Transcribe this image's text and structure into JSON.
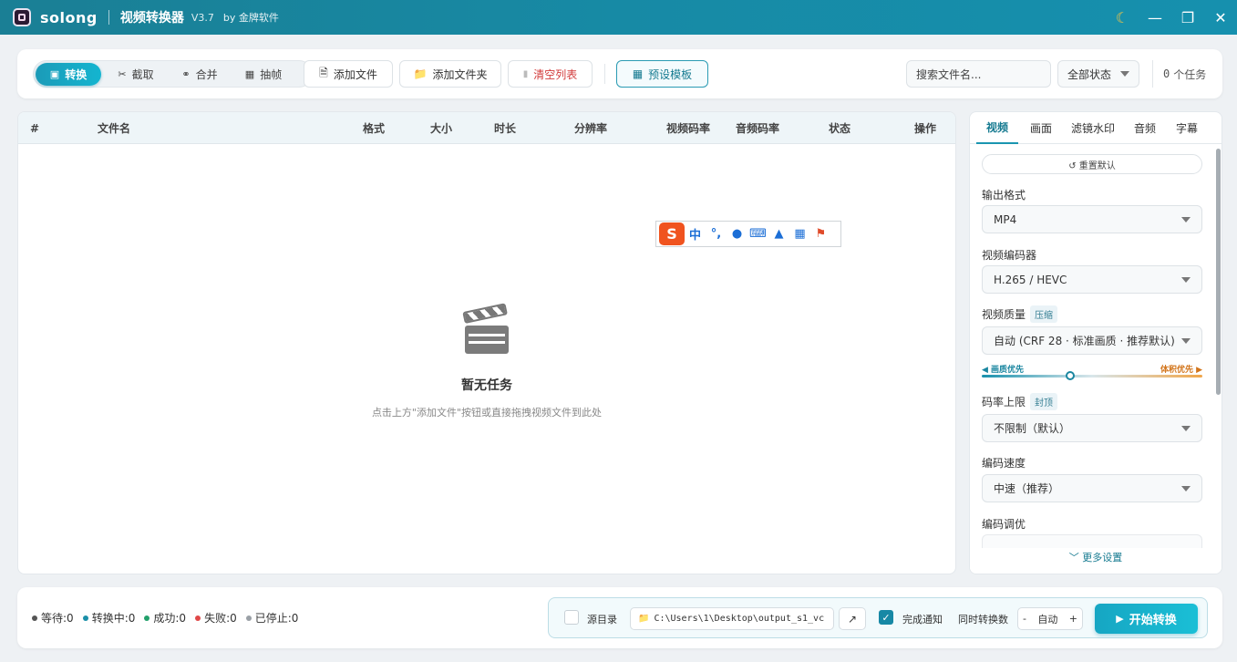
{
  "titlebar": {
    "app_name": "solong",
    "title": "视频转换器",
    "version": "V3.7",
    "by": "by 金牌软件",
    "theme_icon": "moon-icon",
    "minimize": "—",
    "maximize": "❐",
    "close": "✕"
  },
  "toolbar": {
    "modes": [
      {
        "label": "转换",
        "icon": "convert-icon",
        "active": true
      },
      {
        "label": "截取",
        "icon": "scissors-icon"
      },
      {
        "label": "合并",
        "icon": "link-icon"
      },
      {
        "label": "抽帧",
        "icon": "frame-icon"
      }
    ],
    "add_file": "添加文件",
    "add_folder": "添加文件夹",
    "clear_list": "清空列表",
    "preset": "预设模板",
    "search_placeholder": "搜索文件名...",
    "status_filter": "全部状态",
    "task_count": "0",
    "task_unit": "个任务"
  },
  "table": {
    "columns": [
      "#",
      "文件名",
      "格式",
      "大小",
      "时长",
      "分辨率",
      "视频码率",
      "音频码率",
      "状态",
      "操作"
    ],
    "empty_title": "暂无任务",
    "empty_hint": "点击上方\"添加文件\"按钮或直接拖拽视频文件到此处"
  },
  "ime": {
    "logo": "S",
    "items": [
      "中",
      "°,",
      "🎤",
      "⌨",
      "👕",
      "▦",
      "🔧"
    ]
  },
  "settings": {
    "tabs": [
      "视频",
      "画面",
      "滤镜水印",
      "音频",
      "字幕"
    ],
    "active_tab": "视频",
    "reset": "↺ 重置默认",
    "output_format_label": "输出格式",
    "output_format": "MP4",
    "encoder_label": "视频编码器",
    "encoder": "H.265 / HEVC",
    "quality_label": "视频质量",
    "quality_tag": "压缩",
    "quality": "自动 (CRF 28 · 标准画质 · 推荐默认)",
    "slider_left": "◀ 画质优先",
    "slider_right": "体积优先 ▶",
    "slider_value": 0.4,
    "bitrate_label": "码率上限",
    "bitrate_tag": "封顶",
    "bitrate": "不限制（默认）",
    "speed_label": "编码速度",
    "speed": "中速（推荐）",
    "tune_label": "编码调优",
    "more": "﹀ 更多设置"
  },
  "bottom": {
    "stats": [
      {
        "label": "等待:0",
        "color": "#555555"
      },
      {
        "label": "转换中:0",
        "color": "#1a8fa8"
      },
      {
        "label": "成功:0",
        "color": "#22a06b"
      },
      {
        "label": "失败:0",
        "color": "#e04848"
      },
      {
        "label": "已停止:0",
        "color": "#9aa0a6"
      }
    ],
    "source_dir": "源目录",
    "output_path": "C:\\Users\\1\\Desktop\\output_s1_vc",
    "notify": "完成通知",
    "concurrent_label": "同时转换数",
    "concurrent_value": "自动",
    "start": "开始转换"
  }
}
